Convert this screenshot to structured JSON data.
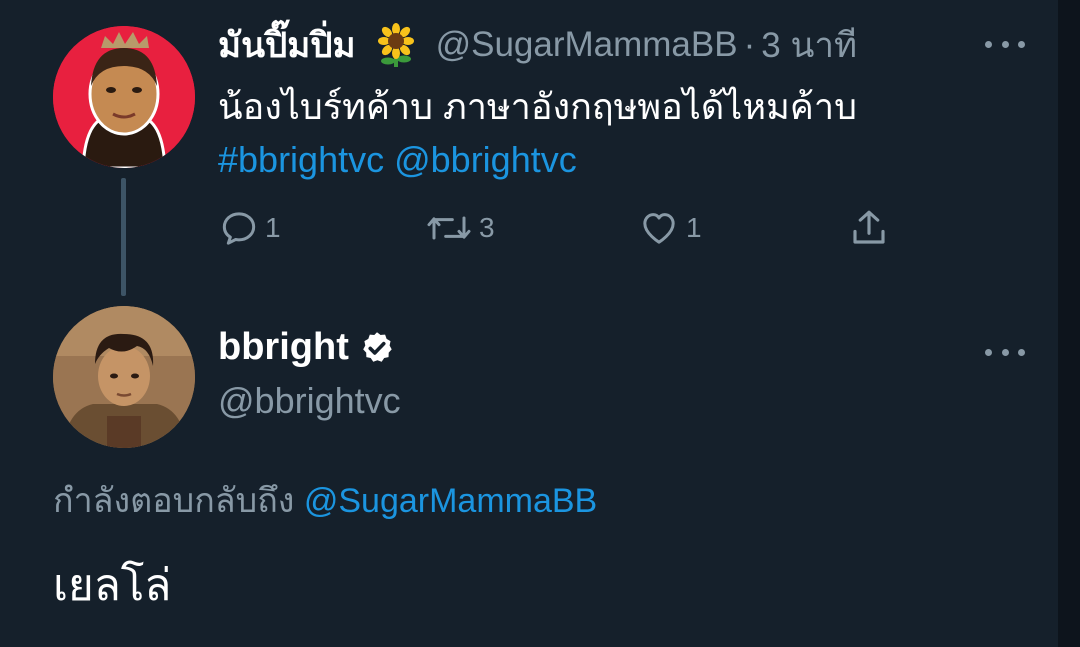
{
  "tweet": {
    "display_name": "มันปิ๊มปิ่ม",
    "emoji": "sunflower-emoji",
    "handle": "@SugarMammaBB",
    "separator": "·",
    "time": "3 นาที",
    "text": "น้องไบร์ทค้าบ ภาษาอังกฤษพอได้ไหมค้าบ",
    "hashtag": "#bbrightvc",
    "mention": "@bbrightvc",
    "actions": {
      "reply_count": "1",
      "retweet_count": "3",
      "like_count": "1"
    }
  },
  "reply": {
    "display_name": "bbright",
    "verified": true,
    "handle": "@bbrightvc",
    "replying_to_label": "กำลังตอบกลับถึง",
    "replying_to_handle": "@SugarMammaBB",
    "text": "เยลโล่"
  },
  "colors": {
    "background": "#15202b",
    "secondary_text": "#8899a6",
    "link": "#1b95e0",
    "avatar_1_bg": "#e8203f"
  }
}
